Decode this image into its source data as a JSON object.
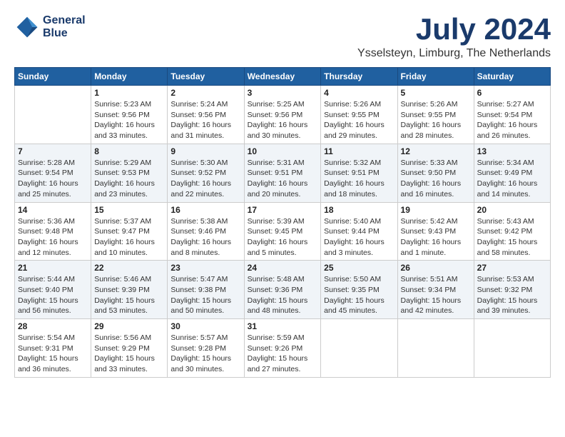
{
  "header": {
    "logo_line1": "General",
    "logo_line2": "Blue",
    "month_year": "July 2024",
    "location": "Ysselsteyn, Limburg, The Netherlands"
  },
  "weekdays": [
    "Sunday",
    "Monday",
    "Tuesday",
    "Wednesday",
    "Thursday",
    "Friday",
    "Saturday"
  ],
  "weeks": [
    [
      {
        "day": "",
        "info": ""
      },
      {
        "day": "1",
        "info": "Sunrise: 5:23 AM\nSunset: 9:56 PM\nDaylight: 16 hours\nand 33 minutes."
      },
      {
        "day": "2",
        "info": "Sunrise: 5:24 AM\nSunset: 9:56 PM\nDaylight: 16 hours\nand 31 minutes."
      },
      {
        "day": "3",
        "info": "Sunrise: 5:25 AM\nSunset: 9:56 PM\nDaylight: 16 hours\nand 30 minutes."
      },
      {
        "day": "4",
        "info": "Sunrise: 5:26 AM\nSunset: 9:55 PM\nDaylight: 16 hours\nand 29 minutes."
      },
      {
        "day": "5",
        "info": "Sunrise: 5:26 AM\nSunset: 9:55 PM\nDaylight: 16 hours\nand 28 minutes."
      },
      {
        "day": "6",
        "info": "Sunrise: 5:27 AM\nSunset: 9:54 PM\nDaylight: 16 hours\nand 26 minutes."
      }
    ],
    [
      {
        "day": "7",
        "info": "Sunrise: 5:28 AM\nSunset: 9:54 PM\nDaylight: 16 hours\nand 25 minutes."
      },
      {
        "day": "8",
        "info": "Sunrise: 5:29 AM\nSunset: 9:53 PM\nDaylight: 16 hours\nand 23 minutes."
      },
      {
        "day": "9",
        "info": "Sunrise: 5:30 AM\nSunset: 9:52 PM\nDaylight: 16 hours\nand 22 minutes."
      },
      {
        "day": "10",
        "info": "Sunrise: 5:31 AM\nSunset: 9:51 PM\nDaylight: 16 hours\nand 20 minutes."
      },
      {
        "day": "11",
        "info": "Sunrise: 5:32 AM\nSunset: 9:51 PM\nDaylight: 16 hours\nand 18 minutes."
      },
      {
        "day": "12",
        "info": "Sunrise: 5:33 AM\nSunset: 9:50 PM\nDaylight: 16 hours\nand 16 minutes."
      },
      {
        "day": "13",
        "info": "Sunrise: 5:34 AM\nSunset: 9:49 PM\nDaylight: 16 hours\nand 14 minutes."
      }
    ],
    [
      {
        "day": "14",
        "info": "Sunrise: 5:36 AM\nSunset: 9:48 PM\nDaylight: 16 hours\nand 12 minutes."
      },
      {
        "day": "15",
        "info": "Sunrise: 5:37 AM\nSunset: 9:47 PM\nDaylight: 16 hours\nand 10 minutes."
      },
      {
        "day": "16",
        "info": "Sunrise: 5:38 AM\nSunset: 9:46 PM\nDaylight: 16 hours\nand 8 minutes."
      },
      {
        "day": "17",
        "info": "Sunrise: 5:39 AM\nSunset: 9:45 PM\nDaylight: 16 hours\nand 5 minutes."
      },
      {
        "day": "18",
        "info": "Sunrise: 5:40 AM\nSunset: 9:44 PM\nDaylight: 16 hours\nand 3 minutes."
      },
      {
        "day": "19",
        "info": "Sunrise: 5:42 AM\nSunset: 9:43 PM\nDaylight: 16 hours\nand 1 minute."
      },
      {
        "day": "20",
        "info": "Sunrise: 5:43 AM\nSunset: 9:42 PM\nDaylight: 15 hours\nand 58 minutes."
      }
    ],
    [
      {
        "day": "21",
        "info": "Sunrise: 5:44 AM\nSunset: 9:40 PM\nDaylight: 15 hours\nand 56 minutes."
      },
      {
        "day": "22",
        "info": "Sunrise: 5:46 AM\nSunset: 9:39 PM\nDaylight: 15 hours\nand 53 minutes."
      },
      {
        "day": "23",
        "info": "Sunrise: 5:47 AM\nSunset: 9:38 PM\nDaylight: 15 hours\nand 50 minutes."
      },
      {
        "day": "24",
        "info": "Sunrise: 5:48 AM\nSunset: 9:36 PM\nDaylight: 15 hours\nand 48 minutes."
      },
      {
        "day": "25",
        "info": "Sunrise: 5:50 AM\nSunset: 9:35 PM\nDaylight: 15 hours\nand 45 minutes."
      },
      {
        "day": "26",
        "info": "Sunrise: 5:51 AM\nSunset: 9:34 PM\nDaylight: 15 hours\nand 42 minutes."
      },
      {
        "day": "27",
        "info": "Sunrise: 5:53 AM\nSunset: 9:32 PM\nDaylight: 15 hours\nand 39 minutes."
      }
    ],
    [
      {
        "day": "28",
        "info": "Sunrise: 5:54 AM\nSunset: 9:31 PM\nDaylight: 15 hours\nand 36 minutes."
      },
      {
        "day": "29",
        "info": "Sunrise: 5:56 AM\nSunset: 9:29 PM\nDaylight: 15 hours\nand 33 minutes."
      },
      {
        "day": "30",
        "info": "Sunrise: 5:57 AM\nSunset: 9:28 PM\nDaylight: 15 hours\nand 30 minutes."
      },
      {
        "day": "31",
        "info": "Sunrise: 5:59 AM\nSunset: 9:26 PM\nDaylight: 15 hours\nand 27 minutes."
      },
      {
        "day": "",
        "info": ""
      },
      {
        "day": "",
        "info": ""
      },
      {
        "day": "",
        "info": ""
      }
    ]
  ]
}
